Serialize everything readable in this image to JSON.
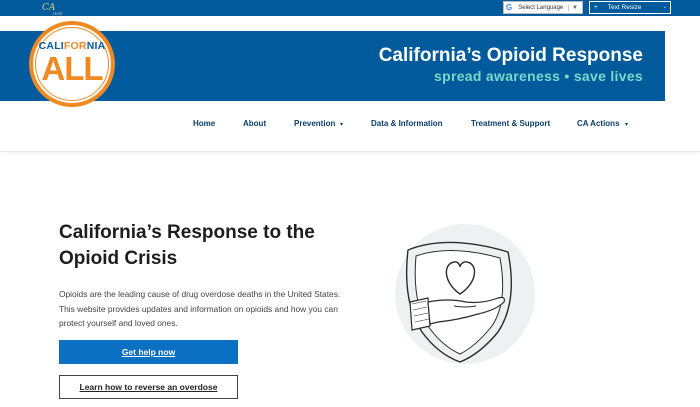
{
  "topbar": {
    "ca_gov_logo": "CA",
    "ca_gov_sub": ".GOV",
    "language_label": "Select Language",
    "language_arrow": "▼",
    "text_resize_plus": "+",
    "text_resize_label": "Text Resize",
    "text_resize_minus": "-"
  },
  "header": {
    "logo_top": {
      "cali": "CALI",
      "for": "FOR",
      "nia": "NIA"
    },
    "logo_bottom": "ALL",
    "title": "California’s Opioid Response",
    "subtitle": "spread awareness • save lives"
  },
  "nav": {
    "items": [
      {
        "label": "Home"
      },
      {
        "label": "About"
      },
      {
        "label": "Prevention",
        "caret": "▲"
      },
      {
        "label": "Data & Information"
      },
      {
        "label": "Treatment & Support"
      },
      {
        "label": "CA Actions",
        "caret": "▲"
      }
    ]
  },
  "hero": {
    "title": "California’s Response to the Opioid Crisis",
    "text": "Opioids are the leading cause of drug overdose deaths in the United States. This website provides updates and information on opioids and how you can protect yourself and loved ones.",
    "primary_button": "Get help now",
    "secondary_button": "Learn how to reverse an overdose"
  },
  "colors": {
    "brand_blue": "#005a9c",
    "accent_orange": "#ef8a23",
    "accent_teal": "#7cd8c8",
    "button_blue": "#0b6fc2",
    "nav_text": "#0b3e6b"
  },
  "icons": [
    "google-icon",
    "shield-heart-hand-illustration"
  ]
}
